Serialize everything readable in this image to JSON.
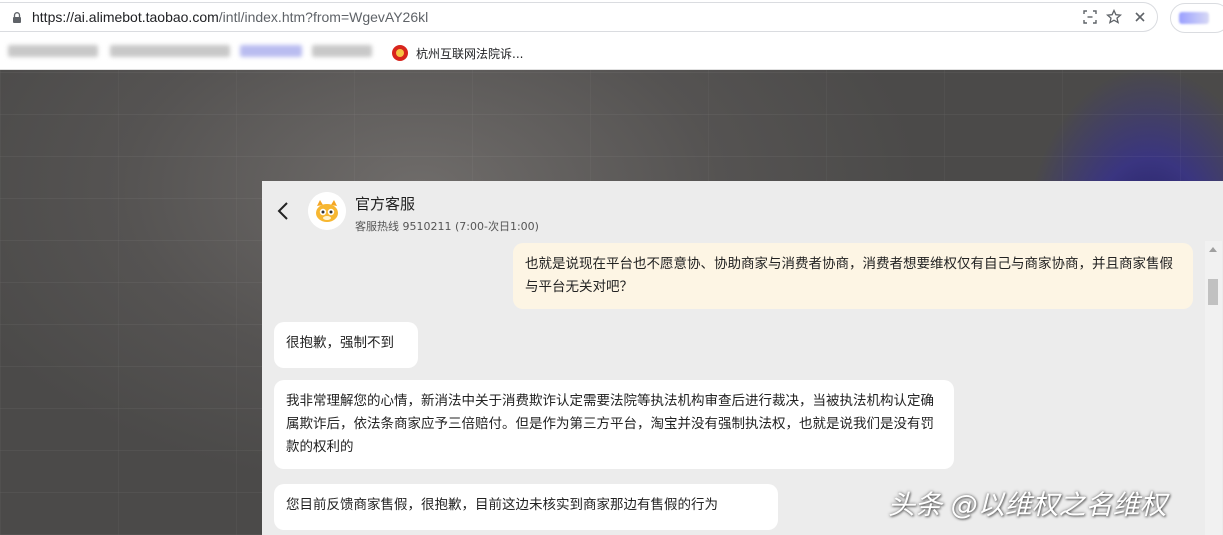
{
  "browser": {
    "url_host": "https://ai.alimebot.taobao.com",
    "url_path": "/intl/index.htm?from=WgevAY26kl",
    "icons": [
      "lock-icon",
      "screenshot-icon",
      "star-icon",
      "close-icon"
    ],
    "bookmarks": {
      "court_label": "杭州互联网法院诉..."
    }
  },
  "chat": {
    "title": "官方客服",
    "subtitle": "客服热线 9510211 (7:00-次日1:00)",
    "messages": [
      {
        "role": "user",
        "text": "也就是说现在平台也不愿意协、协助商家与消费者协商，消费者想要维权仅有自己与商家协商，并且商家售假与平台无关对吧？"
      },
      {
        "role": "bot",
        "text": "很抱歉，强制不到"
      },
      {
        "role": "bot",
        "text": "我非常理解您的心情，新消法中关于消费欺诈认定需要法院等执法机构审查后进行裁决，当被执法机构认定确属欺诈后，依法条商家应予三倍赔付。但是作为第三方平台，淘宝并没有强制执法权，也就是说我们是没有罚款的权利的"
      },
      {
        "role": "bot",
        "text": "您目前反馈商家售假，很抱歉，目前这边未核实到商家那边有售假的行为"
      }
    ]
  },
  "watermark": "头条 @以维权之名维权",
  "colors": {
    "user_bubble": "#fdf5e4",
    "bot_bubble": "#ffffff",
    "panel_bg": "#ececec"
  }
}
